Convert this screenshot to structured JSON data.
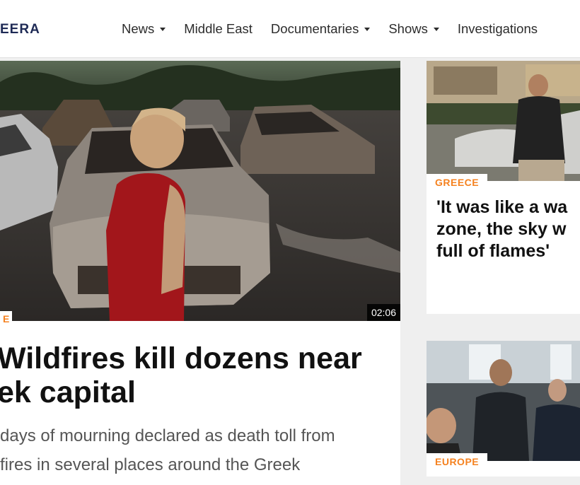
{
  "header": {
    "logo_text": "EERA",
    "nav": [
      {
        "label": "News",
        "has_dropdown": true
      },
      {
        "label": "Middle East",
        "has_dropdown": false
      },
      {
        "label": "Documentaries",
        "has_dropdown": true
      },
      {
        "label": "Shows",
        "has_dropdown": true
      },
      {
        "label": "Investigations",
        "has_dropdown": false
      }
    ]
  },
  "main_story": {
    "tag": "E",
    "duration": "02:06",
    "headline": "Wildfires kill dozens near\nek capital",
    "summary": "days of mourning declared as death toll from\nfires in several places around the Greek"
  },
  "side_stories": [
    {
      "tag": "GREECE",
      "headline": "'It was like a wa\nzone, the sky w\nfull of flames'"
    },
    {
      "tag": "EUROPE",
      "headline": ""
    }
  ],
  "colors": {
    "tag": "#f58220",
    "logo": "#1e2a55"
  }
}
